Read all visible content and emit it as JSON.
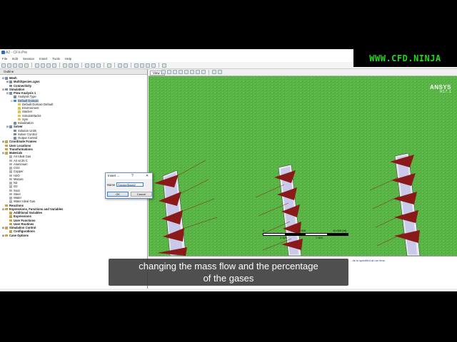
{
  "window": {
    "title": "A2 - CFX-Pre"
  },
  "watermark": "WWW.CFD.NINJA",
  "menu": [
    "File",
    "Edit",
    "Session",
    "Insert",
    "Tools",
    "Help"
  ],
  "outline": {
    "tab_label": "Outline",
    "tree": [
      {
        "label": "Mesh",
        "indent": 0,
        "twisty": "-",
        "bold": true,
        "icon": "mesh"
      },
      {
        "label": "MultiSpecies.cgns",
        "indent": 1,
        "twisty": "+",
        "bold": true,
        "icon": "mesh"
      },
      {
        "label": "Connectivity",
        "indent": 1,
        "twisty": "",
        "bold": true,
        "icon": "mesh"
      },
      {
        "label": "Simulation",
        "indent": 0,
        "twisty": "-",
        "bold": true,
        "icon": "sim"
      },
      {
        "label": "Flow Analysis 1",
        "indent": 1,
        "twisty": "-",
        "bold": true,
        "icon": "sim"
      },
      {
        "label": "Analysis Type",
        "indent": 2,
        "twisty": "",
        "bold": false,
        "icon": "sim"
      },
      {
        "label": "Default Domain",
        "indent": 2,
        "twisty": "-",
        "bold": false,
        "icon": "dom",
        "selected": true
      },
      {
        "label": "Default Domain Default",
        "indent": 3,
        "twisty": "",
        "bold": false,
        "icon": "bc"
      },
      {
        "label": "Environment",
        "indent": 3,
        "twisty": "",
        "bold": false,
        "icon": "bc"
      },
      {
        "label": "Stacker",
        "indent": 3,
        "twisty": "",
        "bold": false,
        "icon": "bc"
      },
      {
        "label": "SimulatStacks",
        "indent": 3,
        "twisty": "",
        "bold": false,
        "icon": "bc"
      },
      {
        "label": "Sym",
        "indent": 3,
        "twisty": "",
        "bold": false,
        "icon": "bc"
      },
      {
        "label": "Initialization",
        "indent": 2,
        "twisty": "",
        "bold": false,
        "icon": "sim"
      },
      {
        "label": "Solver",
        "indent": 1,
        "twisty": "-",
        "bold": true,
        "icon": "sim"
      },
      {
        "label": "Solution Units",
        "indent": 2,
        "twisty": "",
        "bold": false,
        "icon": "sim"
      },
      {
        "label": "Solver Control",
        "indent": 2,
        "twisty": "",
        "bold": false,
        "icon": "sim"
      },
      {
        "label": "Output Control",
        "indent": 2,
        "twisty": "",
        "bold": false,
        "icon": "sim"
      },
      {
        "label": "Coordinate Frames",
        "indent": 0,
        "twisty": "+",
        "bold": true,
        "icon": "grp"
      },
      {
        "label": "User Locations",
        "indent": 0,
        "twisty": "",
        "bold": true,
        "icon": "grp"
      },
      {
        "label": "Transformations",
        "indent": 0,
        "twisty": "",
        "bold": true,
        "icon": "grp"
      },
      {
        "label": "Materials",
        "indent": 0,
        "twisty": "-",
        "bold": true,
        "icon": "grp"
      },
      {
        "label": "Air Ideal Gas",
        "indent": 1,
        "twisty": "",
        "bold": false,
        "icon": "mat"
      },
      {
        "label": "Air at 25 C",
        "indent": 1,
        "twisty": "",
        "bold": false,
        "icon": "mat"
      },
      {
        "label": "Aluminium",
        "indent": 1,
        "twisty": "",
        "bold": false,
        "icon": "mat"
      },
      {
        "label": "CO2",
        "indent": 1,
        "twisty": "",
        "bold": false,
        "icon": "mat"
      },
      {
        "label": "Copper",
        "indent": 1,
        "twisty": "",
        "bold": false,
        "icon": "mat"
      },
      {
        "label": "H2O",
        "indent": 1,
        "twisty": "",
        "bold": false,
        "icon": "mat"
      },
      {
        "label": "Mixture",
        "indent": 1,
        "twisty": "",
        "bold": false,
        "icon": "mat"
      },
      {
        "label": "N2",
        "indent": 1,
        "twisty": "",
        "bold": false,
        "icon": "mat"
      },
      {
        "label": "O2",
        "indent": 1,
        "twisty": "",
        "bold": false,
        "icon": "mat"
      },
      {
        "label": "Soot",
        "indent": 1,
        "twisty": "",
        "bold": false,
        "icon": "mat"
      },
      {
        "label": "Steel",
        "indent": 1,
        "twisty": "",
        "bold": false,
        "icon": "mat"
      },
      {
        "label": "Water",
        "indent": 1,
        "twisty": "",
        "bold": false,
        "icon": "mat"
      },
      {
        "label": "Water Ideal Gas",
        "indent": 1,
        "twisty": "",
        "bold": false,
        "icon": "mat"
      },
      {
        "label": "Reactions",
        "indent": 0,
        "twisty": "",
        "bold": true,
        "icon": "grp"
      },
      {
        "label": "Expressions, Functions and Variables",
        "indent": 0,
        "twisty": "-",
        "bold": true,
        "icon": "grp"
      },
      {
        "label": "Additional Variables",
        "indent": 1,
        "twisty": "",
        "bold": true,
        "icon": "grp"
      },
      {
        "label": "Expressions",
        "indent": 1,
        "twisty": "",
        "bold": true,
        "icon": "grp"
      },
      {
        "label": "User Functions",
        "indent": 1,
        "twisty": "",
        "bold": true,
        "icon": "grp"
      },
      {
        "label": "User Routines",
        "indent": 1,
        "twisty": "",
        "bold": true,
        "icon": "grp"
      },
      {
        "label": "Simulation Control",
        "indent": 0,
        "twisty": "+",
        "bold": true,
        "icon": "grp"
      },
      {
        "label": "Configurations",
        "indent": 1,
        "twisty": "",
        "bold": true,
        "icon": "grp"
      },
      {
        "label": "Case Options",
        "indent": 0,
        "twisty": "+",
        "bold": true,
        "icon": "grp"
      }
    ]
  },
  "viewport": {
    "tab_label": "View 1",
    "logo": "ANSYS",
    "logo_version": "R17.1",
    "scale": {
      "labels_top": [
        "0",
        "5.000",
        "10.000 (m)"
      ],
      "labels_bottom": [
        "2.500",
        "7.500"
      ]
    }
  },
  "messages": {
    "text": "...ile is specified at run time."
  },
  "dialog": {
    "title": "Insert ...",
    "help_glyph": "?",
    "close_glyph": "✕",
    "name_label": "Name",
    "name_value": "SmokeStack2",
    "ok_label": "OK",
    "cancel_label": "Cancel"
  },
  "subtitle": {
    "line1": "changing the mass flow and the percentage",
    "line2": "of the gases"
  },
  "colors": {
    "background_mesh": "#5ebd4a",
    "stack_fin": "#8a1a1a",
    "watermark": "#22d81a"
  }
}
